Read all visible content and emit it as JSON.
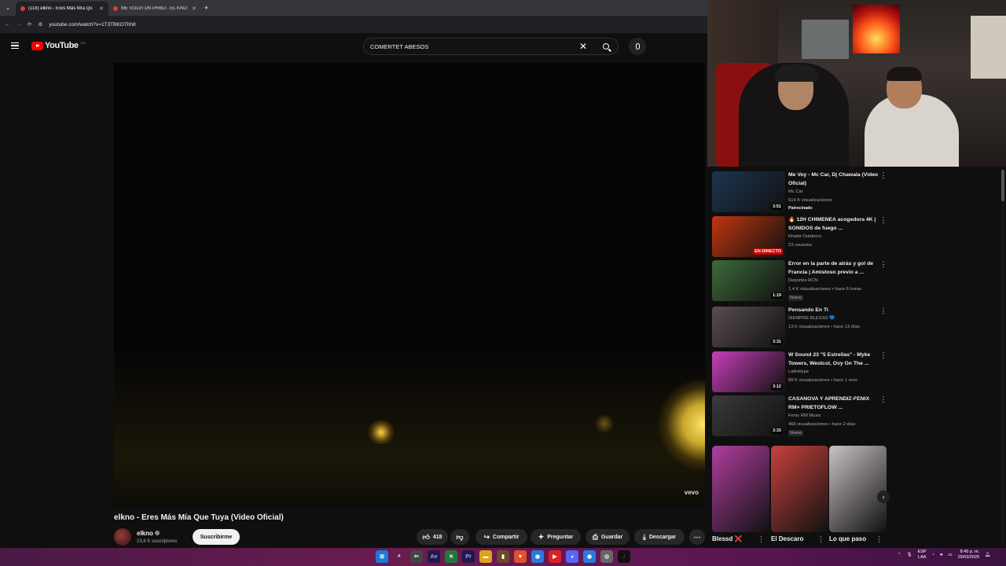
{
  "browser": {
    "tabs": [
      {
        "title": "(118) elkno - Eres Más Mía Qu",
        "active": true
      },
      {
        "title": "ME VOLVI UN PRBO - EL KNO",
        "active": false
      }
    ],
    "url": "youtube.com/watch?v=1T3TBKOThh8"
  },
  "youtube": {
    "logo_text": "YouTube",
    "country_code": "CO",
    "search_value": "COMERTET ABESOS"
  },
  "video": {
    "watermark": "vevo",
    "title": "elkno - Eres Más Mía Que Tuya (Video Oficial)",
    "channel": "elkno",
    "subscribers": "23,6 K suscriptores",
    "subscribe_label": "Suscribirme",
    "likes": "418",
    "share_label": "Compartir",
    "ask_label": "Preguntar",
    "save_label": "Guardar",
    "download_label": "Descargar"
  },
  "recommendations": [
    {
      "title": "Me Voy - Mc Car, Dj Chawala (Video Oficial)",
      "channel": "Mc Car",
      "meta": "514 K visualizaciones",
      "badge": "Patrocinado",
      "duration": "3:51",
      "thumb": "#1b3550"
    },
    {
      "title": "🔥 12H CHIMENEA acogedora 4K | SONIDOS de fuego ...",
      "channel": "Khabir Outdoors",
      "meta": "23 usuarios",
      "badge": "",
      "duration": "EN DIRECTO",
      "thumb": "#c2360f"
    },
    {
      "title": "Error en la parte de atrás y gol de Francia | Amistoso previo a ...",
      "channel": "Deportes RCN",
      "meta": "1,4 K visualizaciones • hace 6 horas",
      "badge": "Nuevo",
      "duration": "1:19",
      "thumb": "#3d6b3a"
    },
    {
      "title": "Pensando En Ti",
      "channel": "SIEMPRE BLESSD 💙",
      "meta": "13 K visualizaciones • hace 13 días",
      "badge": "",
      "duration": "3:31",
      "thumb": "#5a4d52"
    },
    {
      "title": "W Sound 23 \"5 Estrellas\" - Myke Towers, Westcol, Ovy On The ...",
      "channel": "LatinHype",
      "meta": "89 K visualizaciones • hace 1 mes",
      "badge": "",
      "duration": "3:12",
      "thumb": "#c73fb9"
    },
    {
      "title": "CASANOVA Y APRENDIZ-FENIX RM× PRIETOFLOW ...",
      "channel": "Fenix RM Music",
      "meta": "466 visualizaciones • hace 2 días",
      "badge": "Nuevo",
      "duration": "3:33",
      "thumb": "#3a3a3a"
    }
  ],
  "shorts": [
    {
      "label": "Blessd ❌",
      "color": "#b03ea0"
    },
    {
      "label": "El Descaro",
      "color": "#c7413d"
    },
    {
      "label": "Lo que paso",
      "color": "#c9c2c6"
    }
  ],
  "taskbar": {
    "lang": "ESP",
    "lang_sub": "LAA",
    "time": "8:45 p. m.",
    "date": "29/03/2026"
  }
}
